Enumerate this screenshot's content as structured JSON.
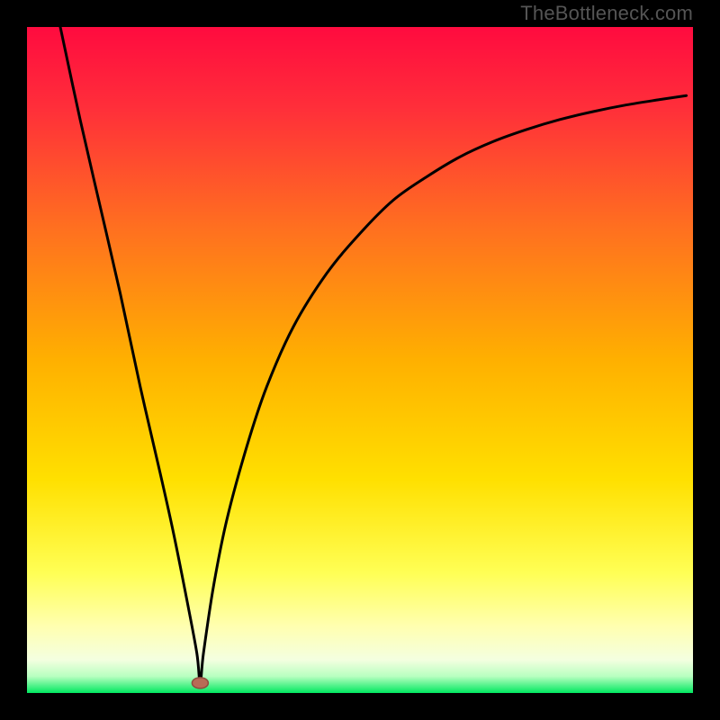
{
  "watermark": "TheBottleneck.com",
  "colors": {
    "top": "#ff0b3f",
    "upper_mid": "#ff7a1a",
    "mid": "#ffd400",
    "lower_mid": "#ffff66",
    "pale": "#ffffd0",
    "bottom": "#00e860",
    "curve": "#000000",
    "marker_fill": "#b96b56",
    "marker_stroke": "#8e4d3e",
    "frame": "#000000"
  },
  "chart_data": {
    "type": "line",
    "title": "",
    "xlabel": "",
    "ylabel": "",
    "xlim": [
      0,
      100
    ],
    "ylim": [
      0,
      100
    ],
    "grid": false,
    "legend": false,
    "annotations": [],
    "marker": {
      "x": 26,
      "y": 1.5
    },
    "series": [
      {
        "name": "bottleneck-curve",
        "x": [
          5,
          8,
          11,
          14,
          17,
          20,
          22,
          24,
          25.5,
          26,
          26.5,
          28,
          30,
          33,
          36,
          40,
          45,
          50,
          55,
          60,
          65,
          70,
          75,
          80,
          85,
          90,
          95,
          99
        ],
        "values": [
          100,
          86,
          73,
          60,
          46,
          33,
          24,
          14,
          6,
          1.5,
          6,
          16,
          26,
          37,
          46,
          55,
          63,
          69,
          74,
          77.5,
          80.5,
          82.8,
          84.6,
          86.1,
          87.3,
          88.3,
          89.1,
          89.7
        ]
      }
    ]
  }
}
